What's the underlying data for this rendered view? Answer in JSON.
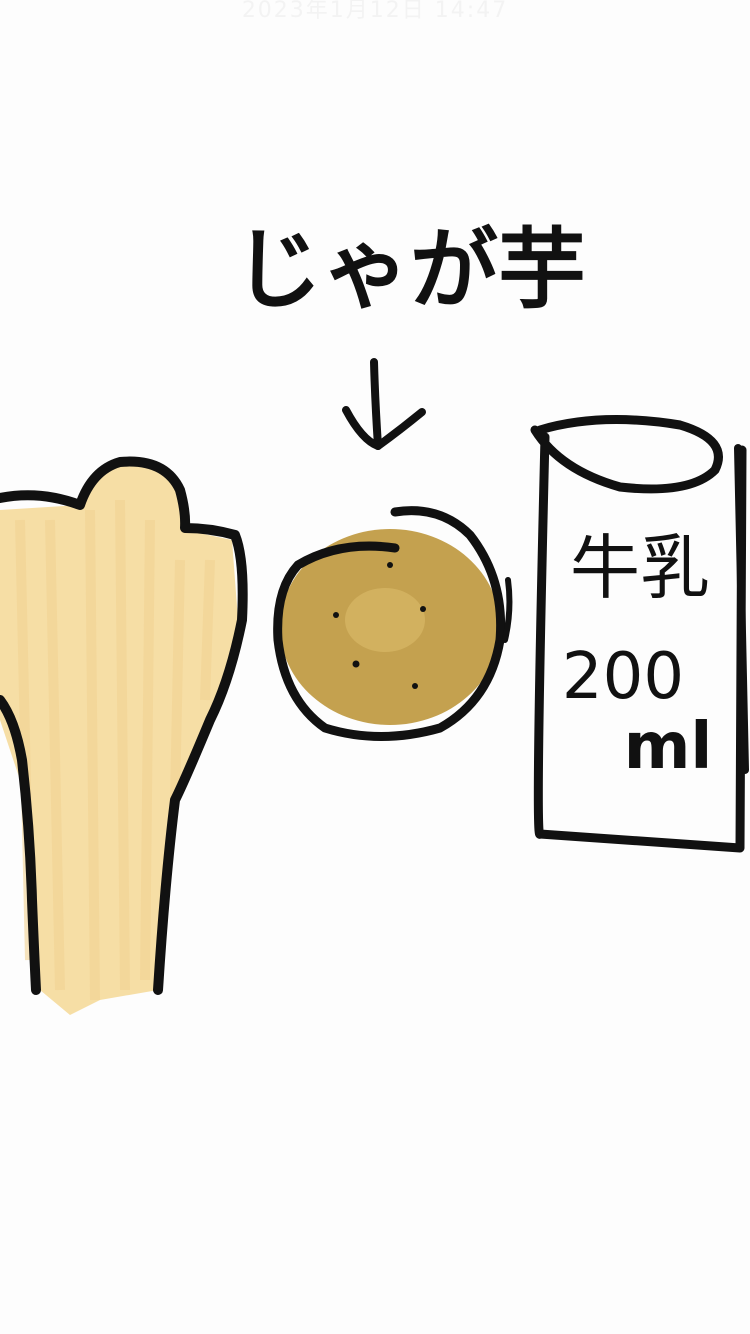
{
  "timestamp": "2023年1月12日 14:47",
  "labels": {
    "potato": "じゃが芋",
    "milk_name": "牛乳",
    "milk_amount": "200",
    "milk_unit": "ml"
  },
  "icons": {
    "bone": "bone-icon",
    "potato": "potato-icon",
    "milk_carton": "milk-carton-icon",
    "arrow": "arrow-down-icon"
  },
  "colors": {
    "ink": "#111111",
    "bone_fill": "#f6dea5",
    "potato_fill": "#c4a14f",
    "background": "#fdfdfd"
  }
}
